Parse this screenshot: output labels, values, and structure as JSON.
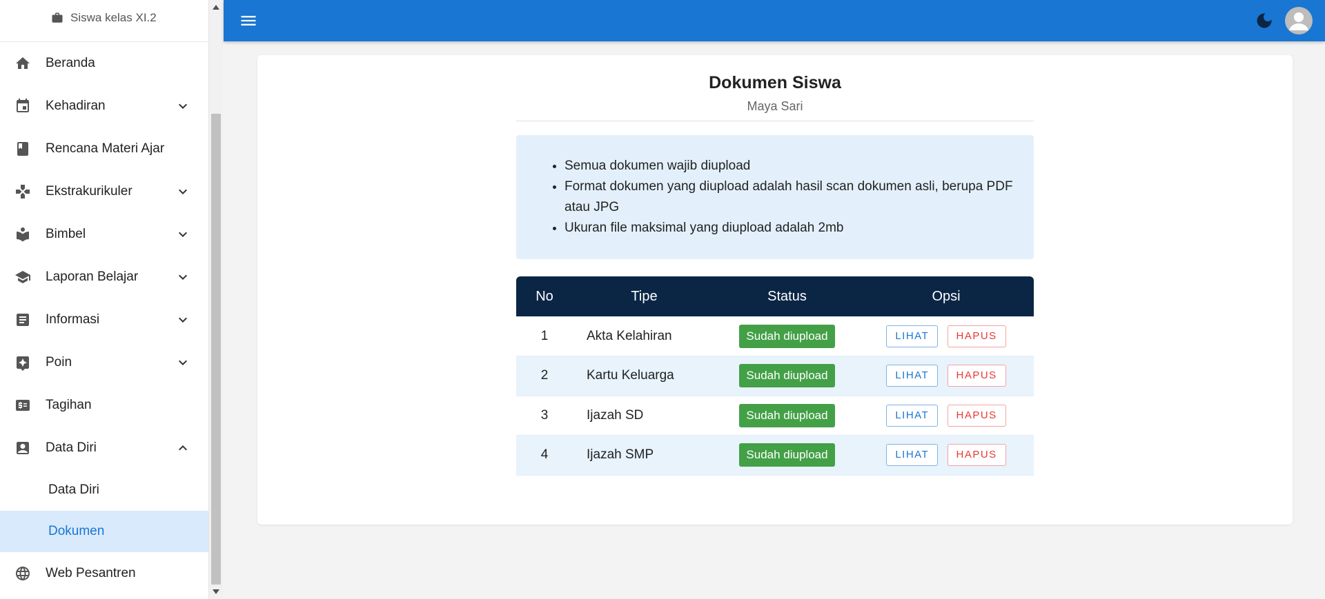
{
  "sidebar": {
    "role": "Siswa kelas XI.2",
    "items": [
      {
        "label": "Beranda",
        "icon": "home-icon"
      },
      {
        "label": "Kehadiran",
        "icon": "calendar-icon"
      },
      {
        "label": "Rencana Materi Ajar",
        "icon": "book-icon"
      },
      {
        "label": "Ekstrakurikuler",
        "icon": "gamepad-icon"
      },
      {
        "label": "Bimbel",
        "icon": "reading-icon"
      },
      {
        "label": "Laporan Belajar",
        "icon": "school-icon"
      },
      {
        "label": "Informasi",
        "icon": "article-icon"
      },
      {
        "label": "Poin",
        "icon": "star-badge-icon"
      },
      {
        "label": "Tagihan",
        "icon": "billing-icon"
      },
      {
        "label": "Data Diri",
        "icon": "contact-icon"
      },
      {
        "label": "Web Pesantren",
        "icon": "globe-icon"
      }
    ],
    "sub_items": [
      {
        "label": "Data Diri"
      },
      {
        "label": "Dokumen"
      }
    ]
  },
  "topbar": {
    "colors": {
      "bar": "#1976d2",
      "moon": "#0b2545"
    }
  },
  "main": {
    "title": "Dokumen Siswa",
    "subtitle": "Maya Sari",
    "notes": [
      "Semua dokumen wajib diupload",
      "Format dokumen yang diupload adalah hasil scan dokumen asli, berupa PDF atau JPG",
      "Ukuran file maksimal yang diupload adalah 2mb"
    ],
    "table": {
      "headers": [
        "No",
        "Tipe",
        "Status",
        "Opsi"
      ],
      "rows": [
        {
          "no": "1",
          "tipe": "Akta Kelahiran",
          "status": "Sudah diupload"
        },
        {
          "no": "2",
          "tipe": "Kartu Keluarga",
          "status": "Sudah diupload"
        },
        {
          "no": "3",
          "tipe": "Ijazah SD",
          "status": "Sudah diupload"
        },
        {
          "no": "4",
          "tipe": "Ijazah SMP",
          "status": "Sudah diupload"
        }
      ],
      "view_label": "LIHAT",
      "delete_label": "HAPUS"
    },
    "colors": {
      "header": "#0b2545",
      "status": "#43a047",
      "accent": "#1976d2",
      "danger": "#e53935"
    }
  }
}
